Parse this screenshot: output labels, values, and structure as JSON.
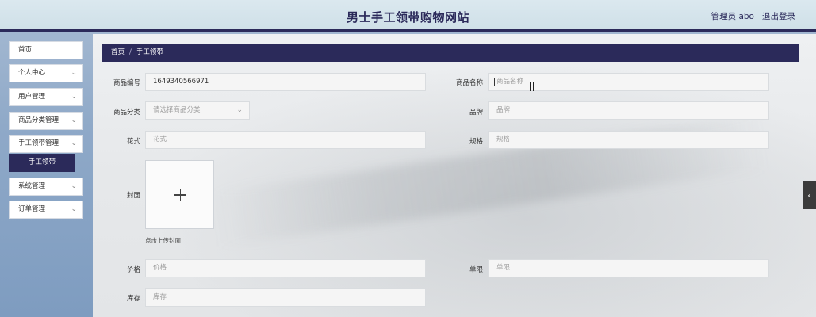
{
  "header": {
    "title": "男士手工领带购物网站",
    "user": "管理员 abo",
    "logout": "退出登录"
  },
  "sidebar": {
    "items": [
      {
        "label": "首页"
      },
      {
        "label": "个人中心"
      },
      {
        "label": "用户管理"
      },
      {
        "label": "商品分类管理"
      },
      {
        "label": "手工领带管理"
      },
      {
        "label": "系统管理"
      },
      {
        "label": "订单管理"
      }
    ],
    "sub_active": "手工领带",
    "chevron": "⌄"
  },
  "breadcrumb": {
    "home": "首页",
    "separator": "/",
    "current": "手工领带"
  },
  "form": {
    "code": {
      "label": "商品编号",
      "value": "1649340566971"
    },
    "name": {
      "label": "商品名称",
      "placeholder": "商品名称"
    },
    "category": {
      "label": "商品分类",
      "placeholder": "请选择商品分类"
    },
    "brand": {
      "label": "品牌",
      "placeholder": "品牌"
    },
    "pattern": {
      "label": "花式",
      "placeholder": "花式"
    },
    "spec": {
      "label": "规格",
      "placeholder": "规格"
    },
    "cover": {
      "label": "封面",
      "hint": "点击上传封面"
    },
    "price": {
      "label": "价格",
      "placeholder": "价格"
    },
    "limit": {
      "label": "单限",
      "placeholder": "单限"
    },
    "stock": {
      "label": "库存",
      "placeholder": "库存"
    }
  },
  "side_tab": {
    "icon": "‹"
  },
  "colors": {
    "accent": "#2b2a5a",
    "header_bg": "#d3e3eb"
  }
}
